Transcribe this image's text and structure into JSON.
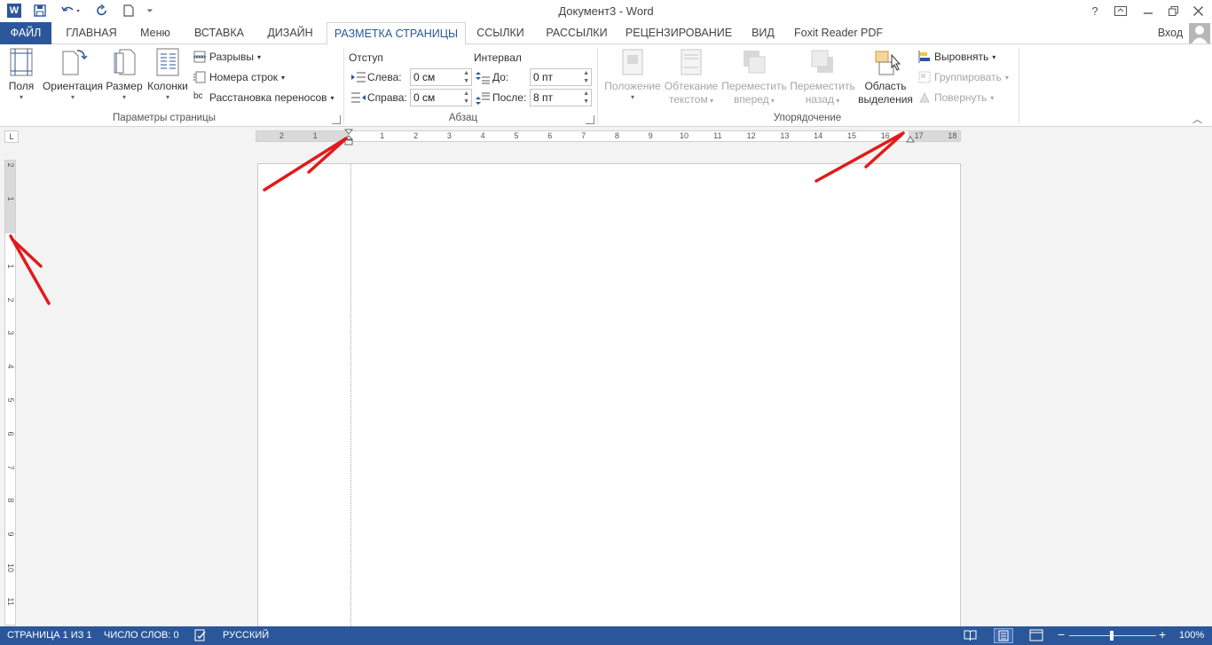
{
  "titlebar": {
    "title": "Документ3 - Word",
    "help": "?",
    "qat": {
      "save_icon": "save-icon",
      "undo_icon": "undo-icon",
      "redo_icon": "redo-icon",
      "new_icon": "new-document-icon"
    }
  },
  "tabs": [
    {
      "label": "ФАЙЛ"
    },
    {
      "label": "ГЛАВНАЯ"
    },
    {
      "label": "Меню"
    },
    {
      "label": "ВСТАВКА"
    },
    {
      "label": "ДИЗАЙН"
    },
    {
      "label": "РАЗМЕТКА СТРАНИЦЫ"
    },
    {
      "label": "ССЫЛКИ"
    },
    {
      "label": "РАССЫЛКИ"
    },
    {
      "label": "РЕЦЕНЗИРОВАНИЕ"
    },
    {
      "label": "ВИД"
    },
    {
      "label": "Foxit Reader PDF"
    }
  ],
  "account": {
    "signin": "Вход"
  },
  "ribbon": {
    "page_setup": {
      "label": "Параметры страницы",
      "margins": "Поля",
      "orientation": "Ориентация",
      "size": "Размер",
      "columns": "Колонки",
      "breaks": "Разрывы",
      "line_numbers": "Номера строк",
      "hyphenation": "Расстановка переносов"
    },
    "paragraph": {
      "label": "Абзац",
      "indent_title": "Отступ",
      "left_label": "Слева:",
      "left_value": "0 см",
      "right_label": "Справа:",
      "right_value": "0 см",
      "spacing_title": "Интервал",
      "before_label": "До:",
      "before_value": "0 пт",
      "after_label": "После:",
      "after_value": "8 пт"
    },
    "arrange": {
      "label": "Упорядочение",
      "position_1": "Положение",
      "wrap_1": "Обтекание",
      "wrap_2": "текстом",
      "forward_1": "Переместить",
      "forward_2": "вперед",
      "backward_1": "Переместить",
      "backward_2": "назад",
      "selection_1": "Область",
      "selection_2": "выделения",
      "align": "Выровнять",
      "group": "Группировать",
      "rotate": "Повернуть"
    }
  },
  "ruler": {
    "h_left": [
      "2",
      "1"
    ],
    "h_right": [
      "1",
      "2",
      "3",
      "4",
      "5",
      "6",
      "7",
      "8",
      "9",
      "10",
      "11",
      "12",
      "13",
      "14",
      "15",
      "16",
      "17",
      "18"
    ],
    "v_top": [
      "2",
      "1"
    ],
    "v_body": [
      "1",
      "2",
      "3",
      "4",
      "5",
      "6",
      "7",
      "8",
      "9",
      "10",
      "11"
    ]
  },
  "status": {
    "page": "СТРАНИЦА 1 ИЗ 1",
    "words": "ЧИСЛО СЛОВ: 0",
    "language": "РУССКИЙ",
    "zoom": "100%"
  },
  "colors": {
    "accent": "#2b579a",
    "arrow": "#e01b1b"
  }
}
